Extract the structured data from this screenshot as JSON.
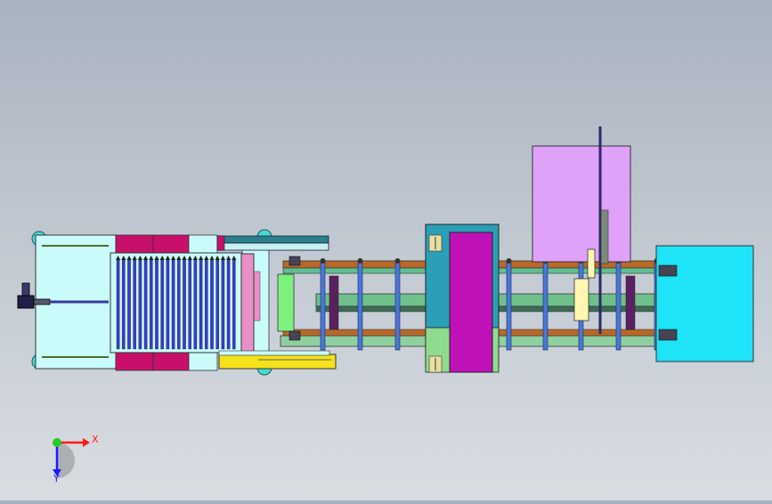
{
  "viewport": {
    "background_top": "#a9b3c0",
    "background_bottom": "#d9dde2"
  },
  "triad": {
    "x_label": "X",
    "y_label": "Y",
    "x_color": "#ff1a1a",
    "y_color": "#1a1aff",
    "origin_color": "#22cc22"
  },
  "colors": {
    "cabinet_body": "#c9fbfb",
    "magenta_block": "#c8106a",
    "blue_tubes": "#3a3ad0",
    "teal_slide": "#2a7f8c",
    "yellow_bar": "#f4e21a",
    "pink_plate": "#e891c8",
    "rail_brown": "#b8692a",
    "rail_green": "#6fd09a",
    "post_blue": "#4a76d8",
    "press_magenta": "#c010b8",
    "lilac_panel": "#e0a2f8",
    "cyan_panel": "#1fe3f7",
    "motor_dark": "#202048"
  }
}
